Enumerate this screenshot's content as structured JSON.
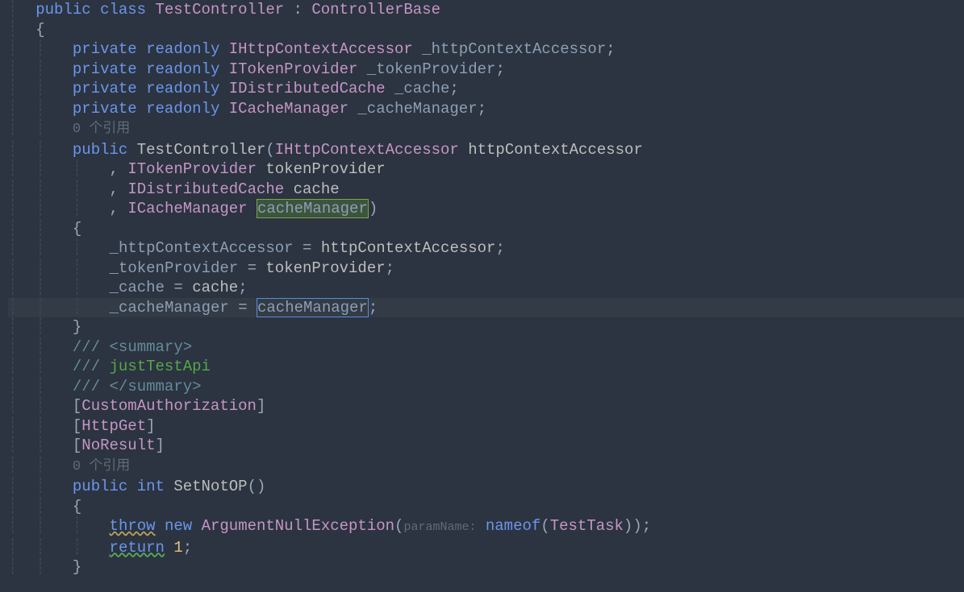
{
  "code": {
    "kw_public": "public",
    "kw_class": "class",
    "className": "TestController",
    "colon": ":",
    "baseClass": "ControllerBase",
    "openBrace": "{",
    "closeBrace": "}",
    "kw_private": "private",
    "kw_readonly": "readonly",
    "field1_type": "IHttpContextAccessor",
    "field1_name": "_httpContextAccessor",
    "field2_type": "ITokenProvider",
    "field2_name": "_tokenProvider",
    "field3_type": "IDistributedCache",
    "field3_name": "_cache",
    "field4_type": "ICacheManager",
    "field4_name": "_cacheManager",
    "codelens": "0 个引用",
    "ctor_name": "TestController",
    "openParen": "(",
    "closeParen": ")",
    "p1_type": "IHttpContextAccessor",
    "p1_name": "httpContextAccessor",
    "p2_type": "ITokenProvider",
    "p2_name": "tokenProvider",
    "p3_type": "IDistributedCache",
    "p3_name": "cache",
    "p4_type": "ICacheManager",
    "p4_name": "cacheManager",
    "comma": ",",
    "assign_eq": "=",
    "assign1_left": "_httpContextAccessor",
    "assign1_right": "httpContextAccessor",
    "assign2_left": "_tokenProvider",
    "assign2_right": "tokenProvider",
    "assign3_left": "_cache",
    "assign3_right": "cache",
    "assign4_left": "_cacheManager",
    "assign4_right": "cacheManager",
    "doc_slash": "///",
    "doc_open": "<summary>",
    "doc_text": " justTestApi",
    "doc_close": "</summary>",
    "doc_lt": "<",
    "doc_gt": ">",
    "doc_summary": "summary",
    "attr1": "CustomAuthorization",
    "attr2": "HttpGet",
    "attr3": "NoResult",
    "bracket_open": "[",
    "bracket_close": "]",
    "kw_int": "int",
    "method_name": "SetNotOP",
    "kw_throw": "throw",
    "kw_new": "new",
    "exception_type": "ArgumentNullException",
    "hint_paramName": "paramName:",
    "kw_nameof": "nameof",
    "nameof_arg": "TestTask",
    "kw_return": "return",
    "return_val": "1",
    "semicolon": ";"
  }
}
